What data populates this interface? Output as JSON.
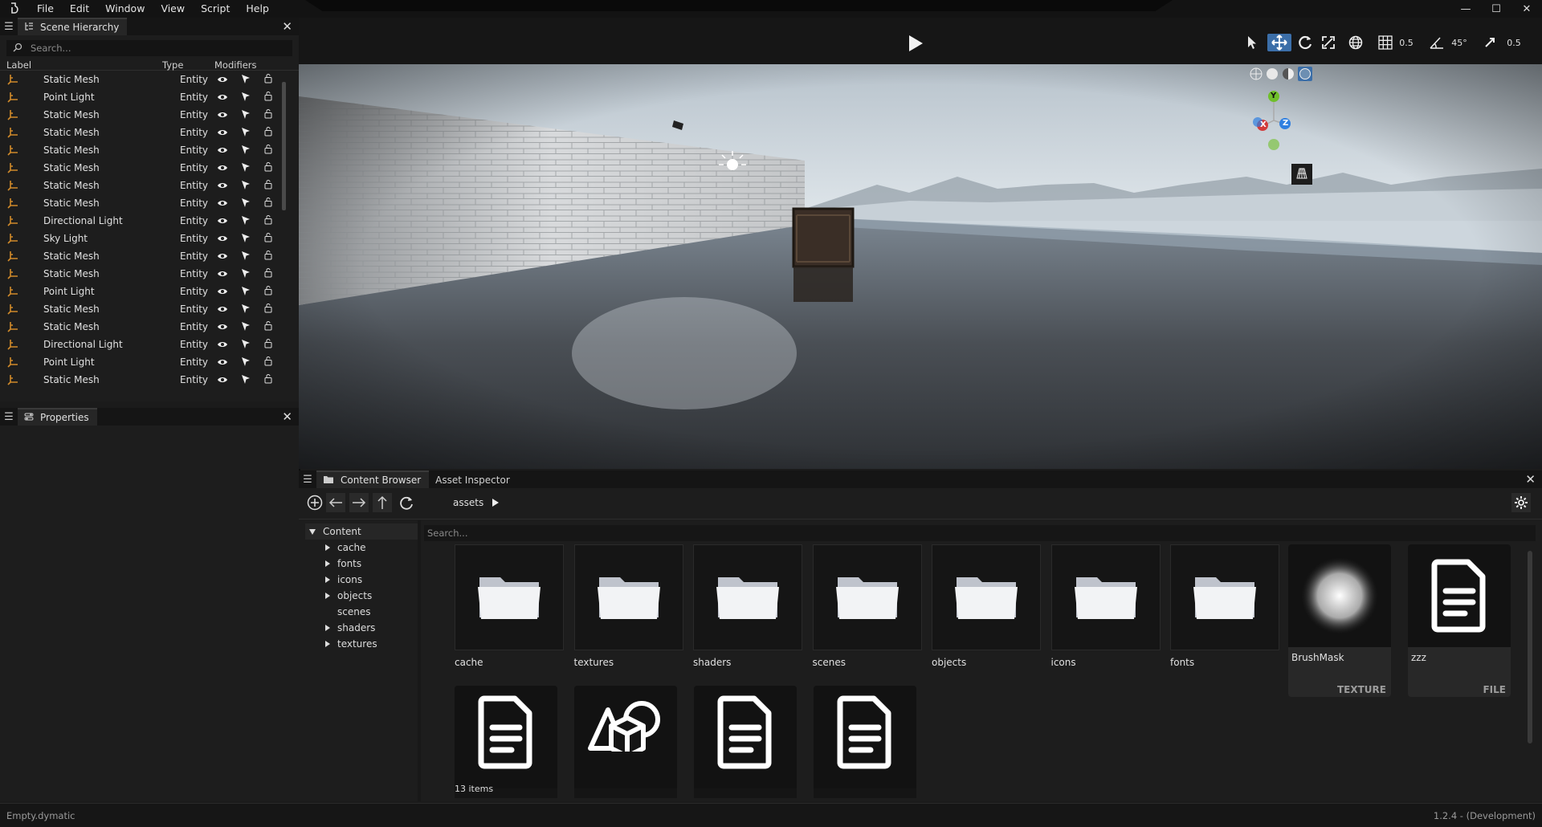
{
  "menubar": {
    "items": [
      "File",
      "Edit",
      "Window",
      "View",
      "Script",
      "Help"
    ]
  },
  "window_controls": [
    "minimize-icon",
    "maximize-icon",
    "close-icon"
  ],
  "hierarchy": {
    "tab_label": "Scene Hierarchy",
    "search_placeholder": "Search...",
    "columns": {
      "label": "Label",
      "type": "Type",
      "modifiers": "Modifiers"
    },
    "rows": [
      {
        "label": "Static Mesh",
        "type": "Entity"
      },
      {
        "label": "Point Light",
        "type": "Entity"
      },
      {
        "label": "Static Mesh",
        "type": "Entity"
      },
      {
        "label": "Static Mesh",
        "type": "Entity"
      },
      {
        "label": "Static Mesh",
        "type": "Entity"
      },
      {
        "label": "Static Mesh",
        "type": "Entity"
      },
      {
        "label": "Static Mesh",
        "type": "Entity"
      },
      {
        "label": "Static Mesh",
        "type": "Entity"
      },
      {
        "label": "Directional Light",
        "type": "Entity"
      },
      {
        "label": "Sky Light",
        "type": "Entity"
      },
      {
        "label": "Static Mesh",
        "type": "Entity"
      },
      {
        "label": "Static Mesh",
        "type": "Entity"
      },
      {
        "label": "Point Light",
        "type": "Entity"
      },
      {
        "label": "Static Mesh",
        "type": "Entity"
      },
      {
        "label": "Static Mesh",
        "type": "Entity"
      },
      {
        "label": "Directional Light",
        "type": "Entity"
      },
      {
        "label": "Point Light",
        "type": "Entity"
      },
      {
        "label": "Static Mesh",
        "type": "Entity"
      }
    ]
  },
  "properties": {
    "tab_label": "Properties"
  },
  "viewport": {
    "snap_translate": "0.5",
    "snap_rotate": "45°",
    "snap_scale": "0.5",
    "axes": {
      "y": "Y",
      "x": "X",
      "z": "Z"
    }
  },
  "content_browser": {
    "tabs": [
      "Content Browser",
      "Asset Inspector"
    ],
    "path": "assets",
    "search_placeholder": "Search...",
    "tree_root": "Content",
    "tree": [
      {
        "label": "cache",
        "expandable": true
      },
      {
        "label": "fonts",
        "expandable": true
      },
      {
        "label": "icons",
        "expandable": true
      },
      {
        "label": "objects",
        "expandable": true
      },
      {
        "label": "scenes",
        "expandable": false
      },
      {
        "label": "shaders",
        "expandable": true
      },
      {
        "label": "textures",
        "expandable": true
      }
    ],
    "folders": [
      "cache",
      "textures",
      "shaders",
      "scenes",
      "objects",
      "icons",
      "fonts"
    ],
    "assets": [
      {
        "name": "BrushMask",
        "kind": "TEXTURE"
      },
      {
        "name": "zzz",
        "kind": "FILE"
      }
    ],
    "item_count": "13 items"
  },
  "status": {
    "left": "Empty.dymatic",
    "right": "1.2.4 - (Development)"
  },
  "colors": {
    "accent_blue": "#3b6ea8",
    "entity_icon": "#d08a2a",
    "axis_x": "#d23b3b",
    "axis_y": "#6fbf2a",
    "axis_z": "#2f7fe0"
  }
}
